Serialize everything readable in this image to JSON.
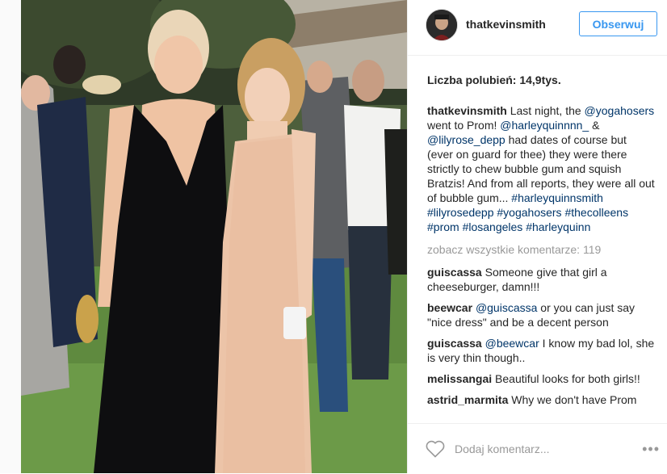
{
  "post": {
    "username": "thatkevinsmith",
    "follow_label": "Obserwuj",
    "likes_text": "Liczba polubień: 14,9tys.",
    "caption": {
      "user": "thatkevinsmith",
      "segments": [
        {
          "t": "Last night, the ",
          "m": false
        },
        {
          "t": "@yogahosers",
          "m": true
        },
        {
          "t": " went to Prom! ",
          "m": false
        },
        {
          "t": "@harleyquinnnn_",
          "m": true
        },
        {
          "t": " & ",
          "m": false
        },
        {
          "t": "@lilyrose_depp",
          "m": true
        },
        {
          "t": " had dates of course but (ever on guard for thee) they were there strictly to chew bubble gum and squish Bratzis! And from all reports, they were all out of bubble gum... ",
          "m": false
        },
        {
          "t": "#harleyquinnsmith",
          "m": true
        },
        {
          "t": " ",
          "m": false
        },
        {
          "t": "#lilyrosedepp",
          "m": true
        },
        {
          "t": " ",
          "m": false
        },
        {
          "t": "#yogahosers",
          "m": true
        },
        {
          "t": " ",
          "m": false
        },
        {
          "t": "#thecolleens",
          "m": true
        },
        {
          "t": " ",
          "m": false
        },
        {
          "t": "#prom",
          "m": true
        },
        {
          "t": " ",
          "m": false
        },
        {
          "t": "#losangeles",
          "m": true
        },
        {
          "t": " ",
          "m": false
        },
        {
          "t": "#harleyquinn",
          "m": true
        }
      ]
    },
    "view_all_comments": "zobacz wszystkie komentarze: 119",
    "comments": [
      {
        "user": "guiscassa",
        "segments": [
          {
            "t": "Someone give that girl a cheeseburger, damn!!!",
            "m": false
          }
        ]
      },
      {
        "user": "beewcar",
        "segments": [
          {
            "t": "@guiscassa",
            "m": true
          },
          {
            "t": " or you can just say \"nice dress\" and be a decent person",
            "m": false
          }
        ]
      },
      {
        "user": "guiscassa",
        "segments": [
          {
            "t": "@beewcar",
            "m": true
          },
          {
            "t": " I know my bad lol, she is very thin though..",
            "m": false
          }
        ]
      },
      {
        "user": "melissangai",
        "segments": [
          {
            "t": "Beautiful looks for both girls!!",
            "m": false
          }
        ]
      },
      {
        "user": "astrid_marmita",
        "segments": [
          {
            "t": "Why we don't have Prom",
            "m": false
          }
        ]
      }
    ],
    "add_comment_placeholder": "Dodaj komentarz...",
    "more_icon": "ellipsis-icon",
    "like_icon": "heart-icon",
    "colors": {
      "accent": "#3897f0",
      "mention": "#003569",
      "muted": "#999999",
      "text": "#262626"
    }
  }
}
